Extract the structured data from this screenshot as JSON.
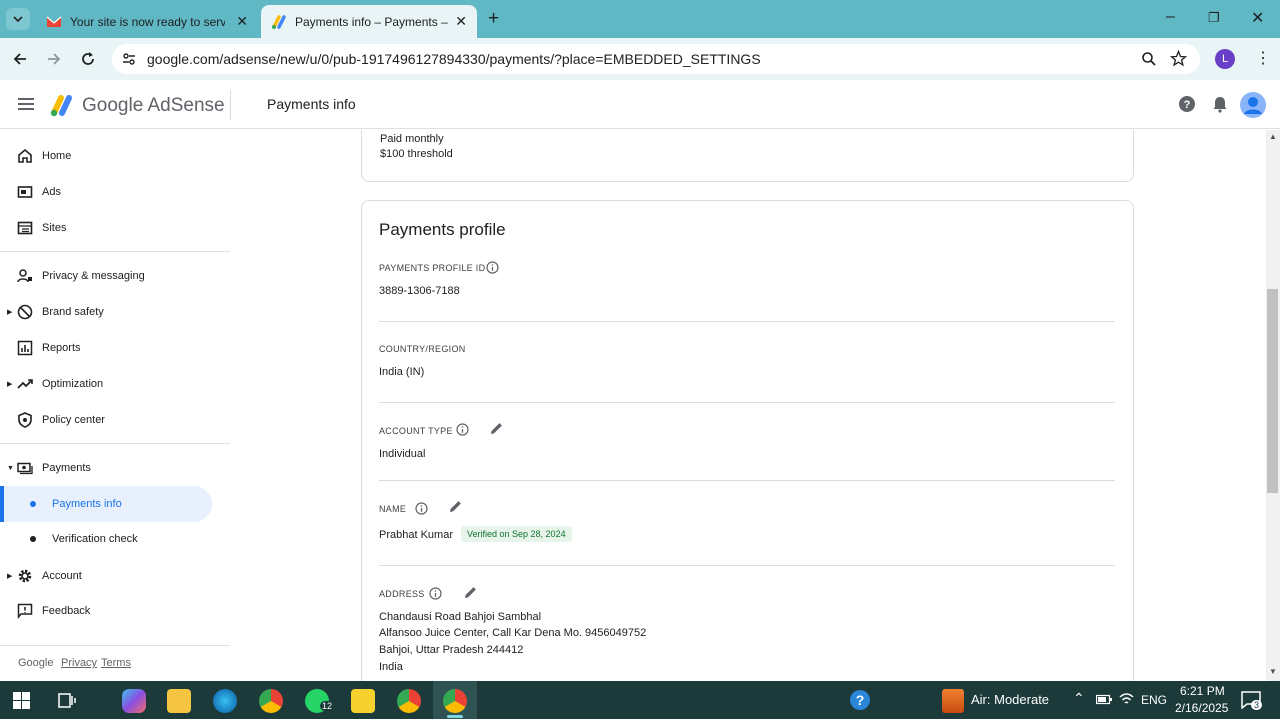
{
  "browser": {
    "tabs": [
      {
        "title": "Your site is now ready to serve a",
        "active": false
      },
      {
        "title": "Payments info – Payments – Go",
        "active": true
      }
    ],
    "url": "google.com/adsense/new/u/0/pub-1917496127894330/payments/?place=EMBEDDED_SETTINGS",
    "profile_initial": "L"
  },
  "header": {
    "brand": "Google AdSense",
    "page_title": "Payments info"
  },
  "sidebar": {
    "items": [
      {
        "label": "Home",
        "icon": "home-icon"
      },
      {
        "label": "Ads",
        "icon": "ads-icon"
      },
      {
        "label": "Sites",
        "icon": "sites-icon"
      },
      {
        "label": "Privacy & messaging",
        "icon": "privacy-icon"
      },
      {
        "label": "Brand safety",
        "icon": "block-icon"
      },
      {
        "label": "Reports",
        "icon": "reports-icon"
      },
      {
        "label": "Optimization",
        "icon": "optimization-icon"
      },
      {
        "label": "Policy center",
        "icon": "policy-icon"
      },
      {
        "label": "Payments",
        "icon": "payments-icon"
      },
      {
        "label": "Payments info",
        "icon": ""
      },
      {
        "label": "Verification check",
        "icon": ""
      },
      {
        "label": "Account",
        "icon": "gear-icon"
      },
      {
        "label": "Feedback",
        "icon": "feedback-icon"
      }
    ],
    "footer": {
      "google": "Google",
      "privacy": "Privacy",
      "terms": "Terms"
    }
  },
  "schedule_card": {
    "line1": "Paid monthly",
    "line2": "$100 threshold"
  },
  "profile_card": {
    "title": "Payments profile",
    "profile_id_label": "PAYMENTS PROFILE ID",
    "profile_id": "3889-1306-7188",
    "country_label": "COUNTRY/REGION",
    "country": "India (IN)",
    "account_type_label": "ACCOUNT TYPE",
    "account_type": "Individual",
    "name_label": "NAME",
    "name": "Prabhat Kumar",
    "name_badge": "Verified on Sep 28, 2024",
    "address_label": "ADDRESS",
    "address_lines": [
      "Chandausi Road Bahjoi Sambhal",
      "Alfansoo Juice Center, Call Kar Dena Mo. 9456049752",
      "Bahjoi, Uttar Pradesh 244412",
      "India"
    ]
  },
  "taskbar": {
    "whatsapp_badge": "12",
    "weather": "Air: Moderate",
    "lang": "ENG",
    "time": "6:21 PM",
    "date": "2/16/2025",
    "notif_count": "3"
  },
  "colors": {
    "accent": "#1a73e8",
    "tabbar": "#5fb8c3",
    "taskbar": "#1c3a3a",
    "verified_bg": "#e6f4ea"
  }
}
